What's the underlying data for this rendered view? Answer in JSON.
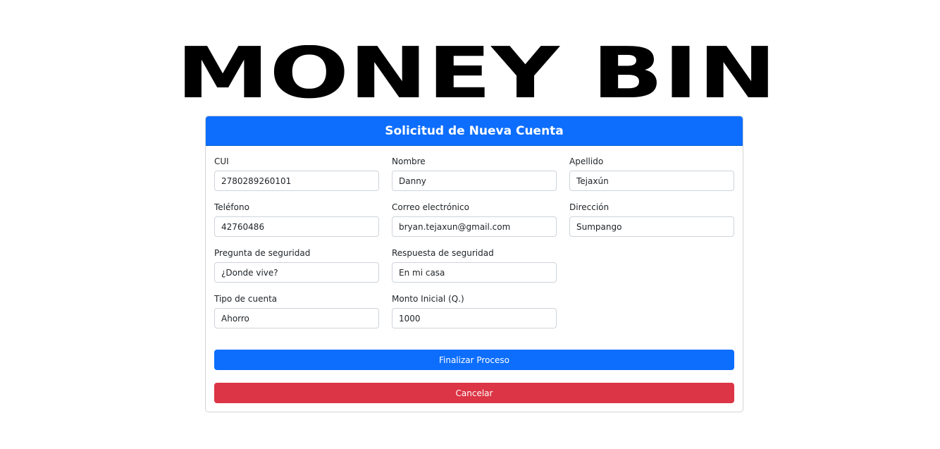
{
  "brand": {
    "logo_text": "MONEY BIN"
  },
  "form": {
    "title": "Solicitud de Nueva Cuenta",
    "fields": {
      "cui": {
        "label": "CUI",
        "value": "2780289260101"
      },
      "nombre": {
        "label": "Nombre",
        "value": "Danny"
      },
      "apellido": {
        "label": "Apellido",
        "value": "Tejaxún"
      },
      "telefono": {
        "label": "Teléfono",
        "value": "42760486"
      },
      "correo": {
        "label": "Correo electrónico",
        "value": "bryan.tejaxun@gmail.com"
      },
      "direccion": {
        "label": "Dirección",
        "value": "Sumpango"
      },
      "pregunta": {
        "label": "Pregunta de seguridad",
        "value": "¿Donde vive?"
      },
      "respuesta": {
        "label": "Respuesta de seguridad",
        "value": "En mi casa"
      },
      "tipo": {
        "label": "Tipo de cuenta",
        "value": "Ahorro"
      },
      "monto": {
        "label": "Monto Inicial (Q.)",
        "value": "1000"
      }
    },
    "buttons": {
      "submit_label": "Finalizar Proceso",
      "cancel_label": "Cancelar"
    }
  },
  "colors": {
    "primary": "#0d6efd",
    "danger": "#dc3545"
  }
}
